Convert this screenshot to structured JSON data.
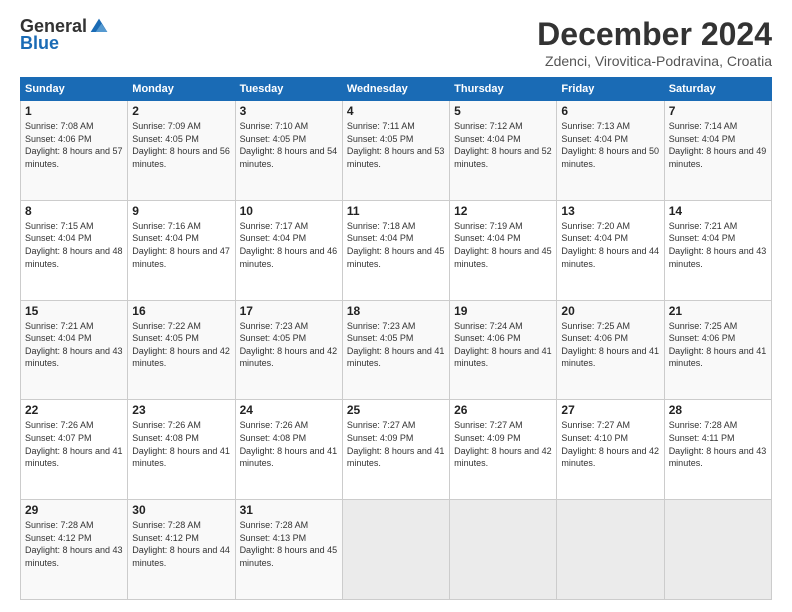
{
  "logo": {
    "general": "General",
    "blue": "Blue"
  },
  "title": "December 2024",
  "subtitle": "Zdenci, Virovitica-Podravina, Croatia",
  "days_header": [
    "Sunday",
    "Monday",
    "Tuesday",
    "Wednesday",
    "Thursday",
    "Friday",
    "Saturday"
  ],
  "weeks": [
    [
      {
        "day": 1,
        "sunrise": "Sunrise: 7:08 AM",
        "sunset": "Sunset: 4:06 PM",
        "daylight": "Daylight: 8 hours and 57 minutes."
      },
      {
        "day": 2,
        "sunrise": "Sunrise: 7:09 AM",
        "sunset": "Sunset: 4:05 PM",
        "daylight": "Daylight: 8 hours and 56 minutes."
      },
      {
        "day": 3,
        "sunrise": "Sunrise: 7:10 AM",
        "sunset": "Sunset: 4:05 PM",
        "daylight": "Daylight: 8 hours and 54 minutes."
      },
      {
        "day": 4,
        "sunrise": "Sunrise: 7:11 AM",
        "sunset": "Sunset: 4:05 PM",
        "daylight": "Daylight: 8 hours and 53 minutes."
      },
      {
        "day": 5,
        "sunrise": "Sunrise: 7:12 AM",
        "sunset": "Sunset: 4:04 PM",
        "daylight": "Daylight: 8 hours and 52 minutes."
      },
      {
        "day": 6,
        "sunrise": "Sunrise: 7:13 AM",
        "sunset": "Sunset: 4:04 PM",
        "daylight": "Daylight: 8 hours and 50 minutes."
      },
      {
        "day": 7,
        "sunrise": "Sunrise: 7:14 AM",
        "sunset": "Sunset: 4:04 PM",
        "daylight": "Daylight: 8 hours and 49 minutes."
      }
    ],
    [
      {
        "day": 8,
        "sunrise": "Sunrise: 7:15 AM",
        "sunset": "Sunset: 4:04 PM",
        "daylight": "Daylight: 8 hours and 48 minutes."
      },
      {
        "day": 9,
        "sunrise": "Sunrise: 7:16 AM",
        "sunset": "Sunset: 4:04 PM",
        "daylight": "Daylight: 8 hours and 47 minutes."
      },
      {
        "day": 10,
        "sunrise": "Sunrise: 7:17 AM",
        "sunset": "Sunset: 4:04 PM",
        "daylight": "Daylight: 8 hours and 46 minutes."
      },
      {
        "day": 11,
        "sunrise": "Sunrise: 7:18 AM",
        "sunset": "Sunset: 4:04 PM",
        "daylight": "Daylight: 8 hours and 45 minutes."
      },
      {
        "day": 12,
        "sunrise": "Sunrise: 7:19 AM",
        "sunset": "Sunset: 4:04 PM",
        "daylight": "Daylight: 8 hours and 45 minutes."
      },
      {
        "day": 13,
        "sunrise": "Sunrise: 7:20 AM",
        "sunset": "Sunset: 4:04 PM",
        "daylight": "Daylight: 8 hours and 44 minutes."
      },
      {
        "day": 14,
        "sunrise": "Sunrise: 7:21 AM",
        "sunset": "Sunset: 4:04 PM",
        "daylight": "Daylight: 8 hours and 43 minutes."
      }
    ],
    [
      {
        "day": 15,
        "sunrise": "Sunrise: 7:21 AM",
        "sunset": "Sunset: 4:04 PM",
        "daylight": "Daylight: 8 hours and 43 minutes."
      },
      {
        "day": 16,
        "sunrise": "Sunrise: 7:22 AM",
        "sunset": "Sunset: 4:05 PM",
        "daylight": "Daylight: 8 hours and 42 minutes."
      },
      {
        "day": 17,
        "sunrise": "Sunrise: 7:23 AM",
        "sunset": "Sunset: 4:05 PM",
        "daylight": "Daylight: 8 hours and 42 minutes."
      },
      {
        "day": 18,
        "sunrise": "Sunrise: 7:23 AM",
        "sunset": "Sunset: 4:05 PM",
        "daylight": "Daylight: 8 hours and 41 minutes."
      },
      {
        "day": 19,
        "sunrise": "Sunrise: 7:24 AM",
        "sunset": "Sunset: 4:06 PM",
        "daylight": "Daylight: 8 hours and 41 minutes."
      },
      {
        "day": 20,
        "sunrise": "Sunrise: 7:25 AM",
        "sunset": "Sunset: 4:06 PM",
        "daylight": "Daylight: 8 hours and 41 minutes."
      },
      {
        "day": 21,
        "sunrise": "Sunrise: 7:25 AM",
        "sunset": "Sunset: 4:06 PM",
        "daylight": "Daylight: 8 hours and 41 minutes."
      }
    ],
    [
      {
        "day": 22,
        "sunrise": "Sunrise: 7:26 AM",
        "sunset": "Sunset: 4:07 PM",
        "daylight": "Daylight: 8 hours and 41 minutes."
      },
      {
        "day": 23,
        "sunrise": "Sunrise: 7:26 AM",
        "sunset": "Sunset: 4:08 PM",
        "daylight": "Daylight: 8 hours and 41 minutes."
      },
      {
        "day": 24,
        "sunrise": "Sunrise: 7:26 AM",
        "sunset": "Sunset: 4:08 PM",
        "daylight": "Daylight: 8 hours and 41 minutes."
      },
      {
        "day": 25,
        "sunrise": "Sunrise: 7:27 AM",
        "sunset": "Sunset: 4:09 PM",
        "daylight": "Daylight: 8 hours and 41 minutes."
      },
      {
        "day": 26,
        "sunrise": "Sunrise: 7:27 AM",
        "sunset": "Sunset: 4:09 PM",
        "daylight": "Daylight: 8 hours and 42 minutes."
      },
      {
        "day": 27,
        "sunrise": "Sunrise: 7:27 AM",
        "sunset": "Sunset: 4:10 PM",
        "daylight": "Daylight: 8 hours and 42 minutes."
      },
      {
        "day": 28,
        "sunrise": "Sunrise: 7:28 AM",
        "sunset": "Sunset: 4:11 PM",
        "daylight": "Daylight: 8 hours and 43 minutes."
      }
    ],
    [
      {
        "day": 29,
        "sunrise": "Sunrise: 7:28 AM",
        "sunset": "Sunset: 4:12 PM",
        "daylight": "Daylight: 8 hours and 43 minutes."
      },
      {
        "day": 30,
        "sunrise": "Sunrise: 7:28 AM",
        "sunset": "Sunset: 4:12 PM",
        "daylight": "Daylight: 8 hours and 44 minutes."
      },
      {
        "day": 31,
        "sunrise": "Sunrise: 7:28 AM",
        "sunset": "Sunset: 4:13 PM",
        "daylight": "Daylight: 8 hours and 45 minutes."
      },
      null,
      null,
      null,
      null
    ]
  ]
}
